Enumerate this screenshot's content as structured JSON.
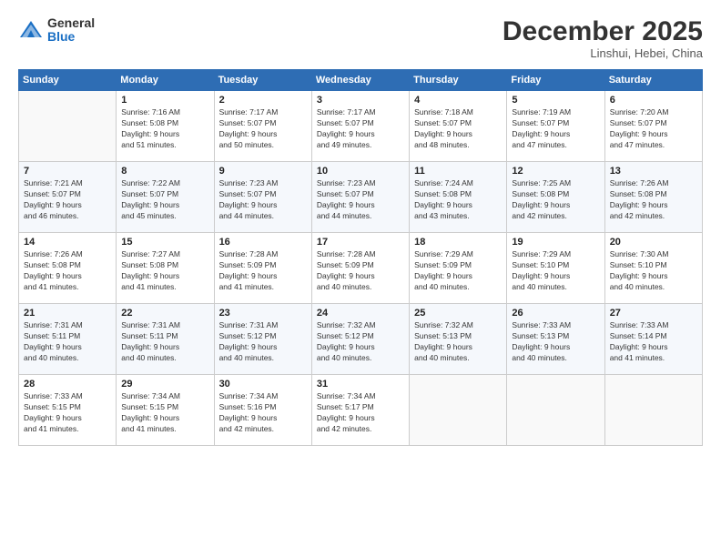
{
  "logo": {
    "general": "General",
    "blue": "Blue"
  },
  "header": {
    "month": "December 2025",
    "location": "Linshui, Hebei, China"
  },
  "days_of_week": [
    "Sunday",
    "Monday",
    "Tuesday",
    "Wednesday",
    "Thursday",
    "Friday",
    "Saturday"
  ],
  "weeks": [
    [
      {
        "day": "",
        "data": ""
      },
      {
        "day": "1",
        "data": "Sunrise: 7:16 AM\nSunset: 5:08 PM\nDaylight: 9 hours\nand 51 minutes."
      },
      {
        "day": "2",
        "data": "Sunrise: 7:17 AM\nSunset: 5:07 PM\nDaylight: 9 hours\nand 50 minutes."
      },
      {
        "day": "3",
        "data": "Sunrise: 7:17 AM\nSunset: 5:07 PM\nDaylight: 9 hours\nand 49 minutes."
      },
      {
        "day": "4",
        "data": "Sunrise: 7:18 AM\nSunset: 5:07 PM\nDaylight: 9 hours\nand 48 minutes."
      },
      {
        "day": "5",
        "data": "Sunrise: 7:19 AM\nSunset: 5:07 PM\nDaylight: 9 hours\nand 47 minutes."
      },
      {
        "day": "6",
        "data": "Sunrise: 7:20 AM\nSunset: 5:07 PM\nDaylight: 9 hours\nand 47 minutes."
      }
    ],
    [
      {
        "day": "7",
        "data": "Sunrise: 7:21 AM\nSunset: 5:07 PM\nDaylight: 9 hours\nand 46 minutes."
      },
      {
        "day": "8",
        "data": "Sunrise: 7:22 AM\nSunset: 5:07 PM\nDaylight: 9 hours\nand 45 minutes."
      },
      {
        "day": "9",
        "data": "Sunrise: 7:23 AM\nSunset: 5:07 PM\nDaylight: 9 hours\nand 44 minutes."
      },
      {
        "day": "10",
        "data": "Sunrise: 7:23 AM\nSunset: 5:07 PM\nDaylight: 9 hours\nand 44 minutes."
      },
      {
        "day": "11",
        "data": "Sunrise: 7:24 AM\nSunset: 5:08 PM\nDaylight: 9 hours\nand 43 minutes."
      },
      {
        "day": "12",
        "data": "Sunrise: 7:25 AM\nSunset: 5:08 PM\nDaylight: 9 hours\nand 42 minutes."
      },
      {
        "day": "13",
        "data": "Sunrise: 7:26 AM\nSunset: 5:08 PM\nDaylight: 9 hours\nand 42 minutes."
      }
    ],
    [
      {
        "day": "14",
        "data": "Sunrise: 7:26 AM\nSunset: 5:08 PM\nDaylight: 9 hours\nand 41 minutes."
      },
      {
        "day": "15",
        "data": "Sunrise: 7:27 AM\nSunset: 5:08 PM\nDaylight: 9 hours\nand 41 minutes."
      },
      {
        "day": "16",
        "data": "Sunrise: 7:28 AM\nSunset: 5:09 PM\nDaylight: 9 hours\nand 41 minutes."
      },
      {
        "day": "17",
        "data": "Sunrise: 7:28 AM\nSunset: 5:09 PM\nDaylight: 9 hours\nand 40 minutes."
      },
      {
        "day": "18",
        "data": "Sunrise: 7:29 AM\nSunset: 5:09 PM\nDaylight: 9 hours\nand 40 minutes."
      },
      {
        "day": "19",
        "data": "Sunrise: 7:29 AM\nSunset: 5:10 PM\nDaylight: 9 hours\nand 40 minutes."
      },
      {
        "day": "20",
        "data": "Sunrise: 7:30 AM\nSunset: 5:10 PM\nDaylight: 9 hours\nand 40 minutes."
      }
    ],
    [
      {
        "day": "21",
        "data": "Sunrise: 7:31 AM\nSunset: 5:11 PM\nDaylight: 9 hours\nand 40 minutes."
      },
      {
        "day": "22",
        "data": "Sunrise: 7:31 AM\nSunset: 5:11 PM\nDaylight: 9 hours\nand 40 minutes."
      },
      {
        "day": "23",
        "data": "Sunrise: 7:31 AM\nSunset: 5:12 PM\nDaylight: 9 hours\nand 40 minutes."
      },
      {
        "day": "24",
        "data": "Sunrise: 7:32 AM\nSunset: 5:12 PM\nDaylight: 9 hours\nand 40 minutes."
      },
      {
        "day": "25",
        "data": "Sunrise: 7:32 AM\nSunset: 5:13 PM\nDaylight: 9 hours\nand 40 minutes."
      },
      {
        "day": "26",
        "data": "Sunrise: 7:33 AM\nSunset: 5:13 PM\nDaylight: 9 hours\nand 40 minutes."
      },
      {
        "day": "27",
        "data": "Sunrise: 7:33 AM\nSunset: 5:14 PM\nDaylight: 9 hours\nand 41 minutes."
      }
    ],
    [
      {
        "day": "28",
        "data": "Sunrise: 7:33 AM\nSunset: 5:15 PM\nDaylight: 9 hours\nand 41 minutes."
      },
      {
        "day": "29",
        "data": "Sunrise: 7:34 AM\nSunset: 5:15 PM\nDaylight: 9 hours\nand 41 minutes."
      },
      {
        "day": "30",
        "data": "Sunrise: 7:34 AM\nSunset: 5:16 PM\nDaylight: 9 hours\nand 42 minutes."
      },
      {
        "day": "31",
        "data": "Sunrise: 7:34 AM\nSunset: 5:17 PM\nDaylight: 9 hours\nand 42 minutes."
      },
      {
        "day": "",
        "data": ""
      },
      {
        "day": "",
        "data": ""
      },
      {
        "day": "",
        "data": ""
      }
    ]
  ]
}
